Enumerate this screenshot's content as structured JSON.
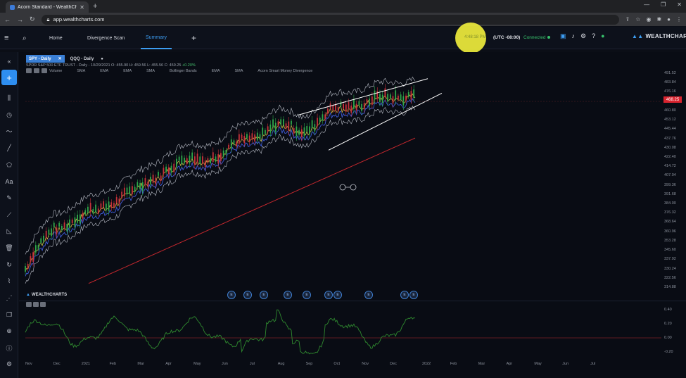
{
  "browser": {
    "tab_title": "Acorn Standard - WealthCharts",
    "url": "app.wealthcharts.com"
  },
  "header": {
    "nav": [
      {
        "label": "Home"
      },
      {
        "label": "Divergence Scan"
      },
      {
        "label": "Summary",
        "active": true
      }
    ],
    "time": "4:48:18 PM",
    "timezone": "(UTC -08:00)",
    "status": "Connected",
    "brand": "WEALTHCHARTS"
  },
  "chart": {
    "tabs": [
      {
        "label": "SPY - Daily",
        "active": true
      },
      {
        "label": "QQQ - Daily",
        "active": false
      }
    ],
    "ohlc_label": "SPDR S&P 500 ETF TRUST",
    "ohlc_meta": "- Daily - 10/29/2021 O: 455.90 H: 459.56 L: 455.56 C: 459.25",
    "ohlc_change": "+0.20%",
    "indicators": [
      "Volume",
      "SMA",
      "EMA",
      "EMA",
      "SMA",
      "Bollinger Bands",
      "EMA",
      "SMA",
      "Acorn Smart Money Divergence"
    ],
    "last_price": "468.25",
    "lower_brand": "WEALTHCHARTS",
    "colors": {
      "background": "#090c14",
      "ema_fast": "#e2c14a",
      "ema_slow": "#3f5bd6",
      "sma_long": "#c1272d",
      "oscillator": "#2f8a2f",
      "accent": "#3d9df2"
    }
  },
  "chart_data": {
    "type": "line",
    "title": "",
    "price_axis": [
      "491.52",
      "483.84",
      "476.16",
      "468.25",
      "460.80",
      "453.12",
      "445.44",
      "437.76",
      "430.08",
      "422.40",
      "414.72",
      "407.04",
      "399.36",
      "391.68",
      "384.00",
      "376.32",
      "368.64",
      "360.96",
      "353.28",
      "345.60",
      "337.92",
      "330.24",
      "322.56",
      "314.88"
    ],
    "osc_axis": [
      "0.40",
      "0.20",
      "0.00",
      "-0.20"
    ],
    "x_labels": [
      "Nov",
      "Dec",
      "2021",
      "Feb",
      "Mar",
      "Apr",
      "May",
      "Jun",
      "Jul",
      "Aug",
      "Sep",
      "Oct",
      "Nov",
      "Dec",
      "2022",
      "Feb",
      "Mar",
      "Apr",
      "May",
      "Jun",
      "Jul"
    ],
    "series": [
      {
        "name": "Volume",
        "values": []
      }
    ],
    "approx_close_by_month": [
      330,
      365,
      372,
      385,
      395,
      413,
      420,
      425,
      438,
      448,
      445,
      460,
      468,
      470,
      477
    ],
    "ylim": [
      314.88,
      491.52
    ]
  }
}
